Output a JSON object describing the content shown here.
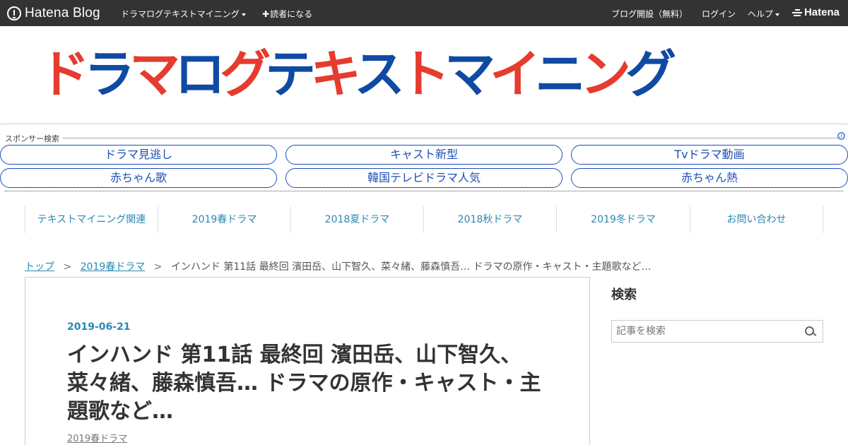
{
  "topbar": {
    "logo_text": "Hatena Blog",
    "blog_menu_label": "ドラマログテキストマイニング",
    "subscribe_label": "読者になる",
    "subscribe_plus": "✚",
    "open_blog_label": "ブログ開設（無料）",
    "login_label": "ログイン",
    "help_label": "ヘルプ",
    "hatena_label": "Hatena"
  },
  "header": {
    "banner_chars": [
      "ド",
      "ラ",
      "マ",
      "ロ",
      "グ",
      "テ",
      "キ",
      "ス",
      "ト",
      "マ",
      "イ",
      "ニ",
      "ン",
      "グ"
    ],
    "banner_colors": [
      "#e63b2e",
      "#0f4aa3",
      "#e63b2e",
      "#0f4aa3",
      "#e63b2e",
      "#0f4aa3",
      "#e63b2e",
      "#0f4aa3",
      "#e63b2e",
      "#0f4aa3",
      "#e63b2e",
      "#0f4aa3",
      "#e63b2e",
      "#0f4aa3"
    ]
  },
  "sponsor": {
    "label": "スポンサー検索",
    "info_icon": "ⓘ",
    "buttons": [
      "ドラマ見逃し",
      "キャスト新型",
      "Tvドラマ動画",
      "赤ちゃん歌",
      "韓国テレビドラマ人気",
      "赤ちゃん熱"
    ]
  },
  "nav": {
    "categories": [
      "テキストマイニング関連",
      "2019春ドラマ",
      "2018夏ドラマ",
      "2018秋ドラマ",
      "2019冬ドラマ",
      "お問い合わせ"
    ]
  },
  "breadcrumb": {
    "top": "トップ",
    "separator": ">",
    "category": "2019春ドラマ",
    "current": "インハンド 第11話 最終回 濱田岳、山下智久、菜々緒、藤森慎吾… ドラマの原作・キャスト・主題歌など…"
  },
  "article": {
    "date": "2019-06-21",
    "title": "インハンド 第11話 最終回 濱田岳、山下智久、菜々緒、藤森慎吾… ドラマの原作・キャスト・主題歌など…",
    "category": "2019春ドラマ"
  },
  "sidebar": {
    "search_title": "検索",
    "search_placeholder": "記事を検索"
  },
  "colors": {
    "topbar_bg": "#333333",
    "link": "#2a88b4",
    "sponsor_link": "#1d4fb5",
    "banner_red": "#e63b2e",
    "banner_blue": "#0f4aa3"
  }
}
